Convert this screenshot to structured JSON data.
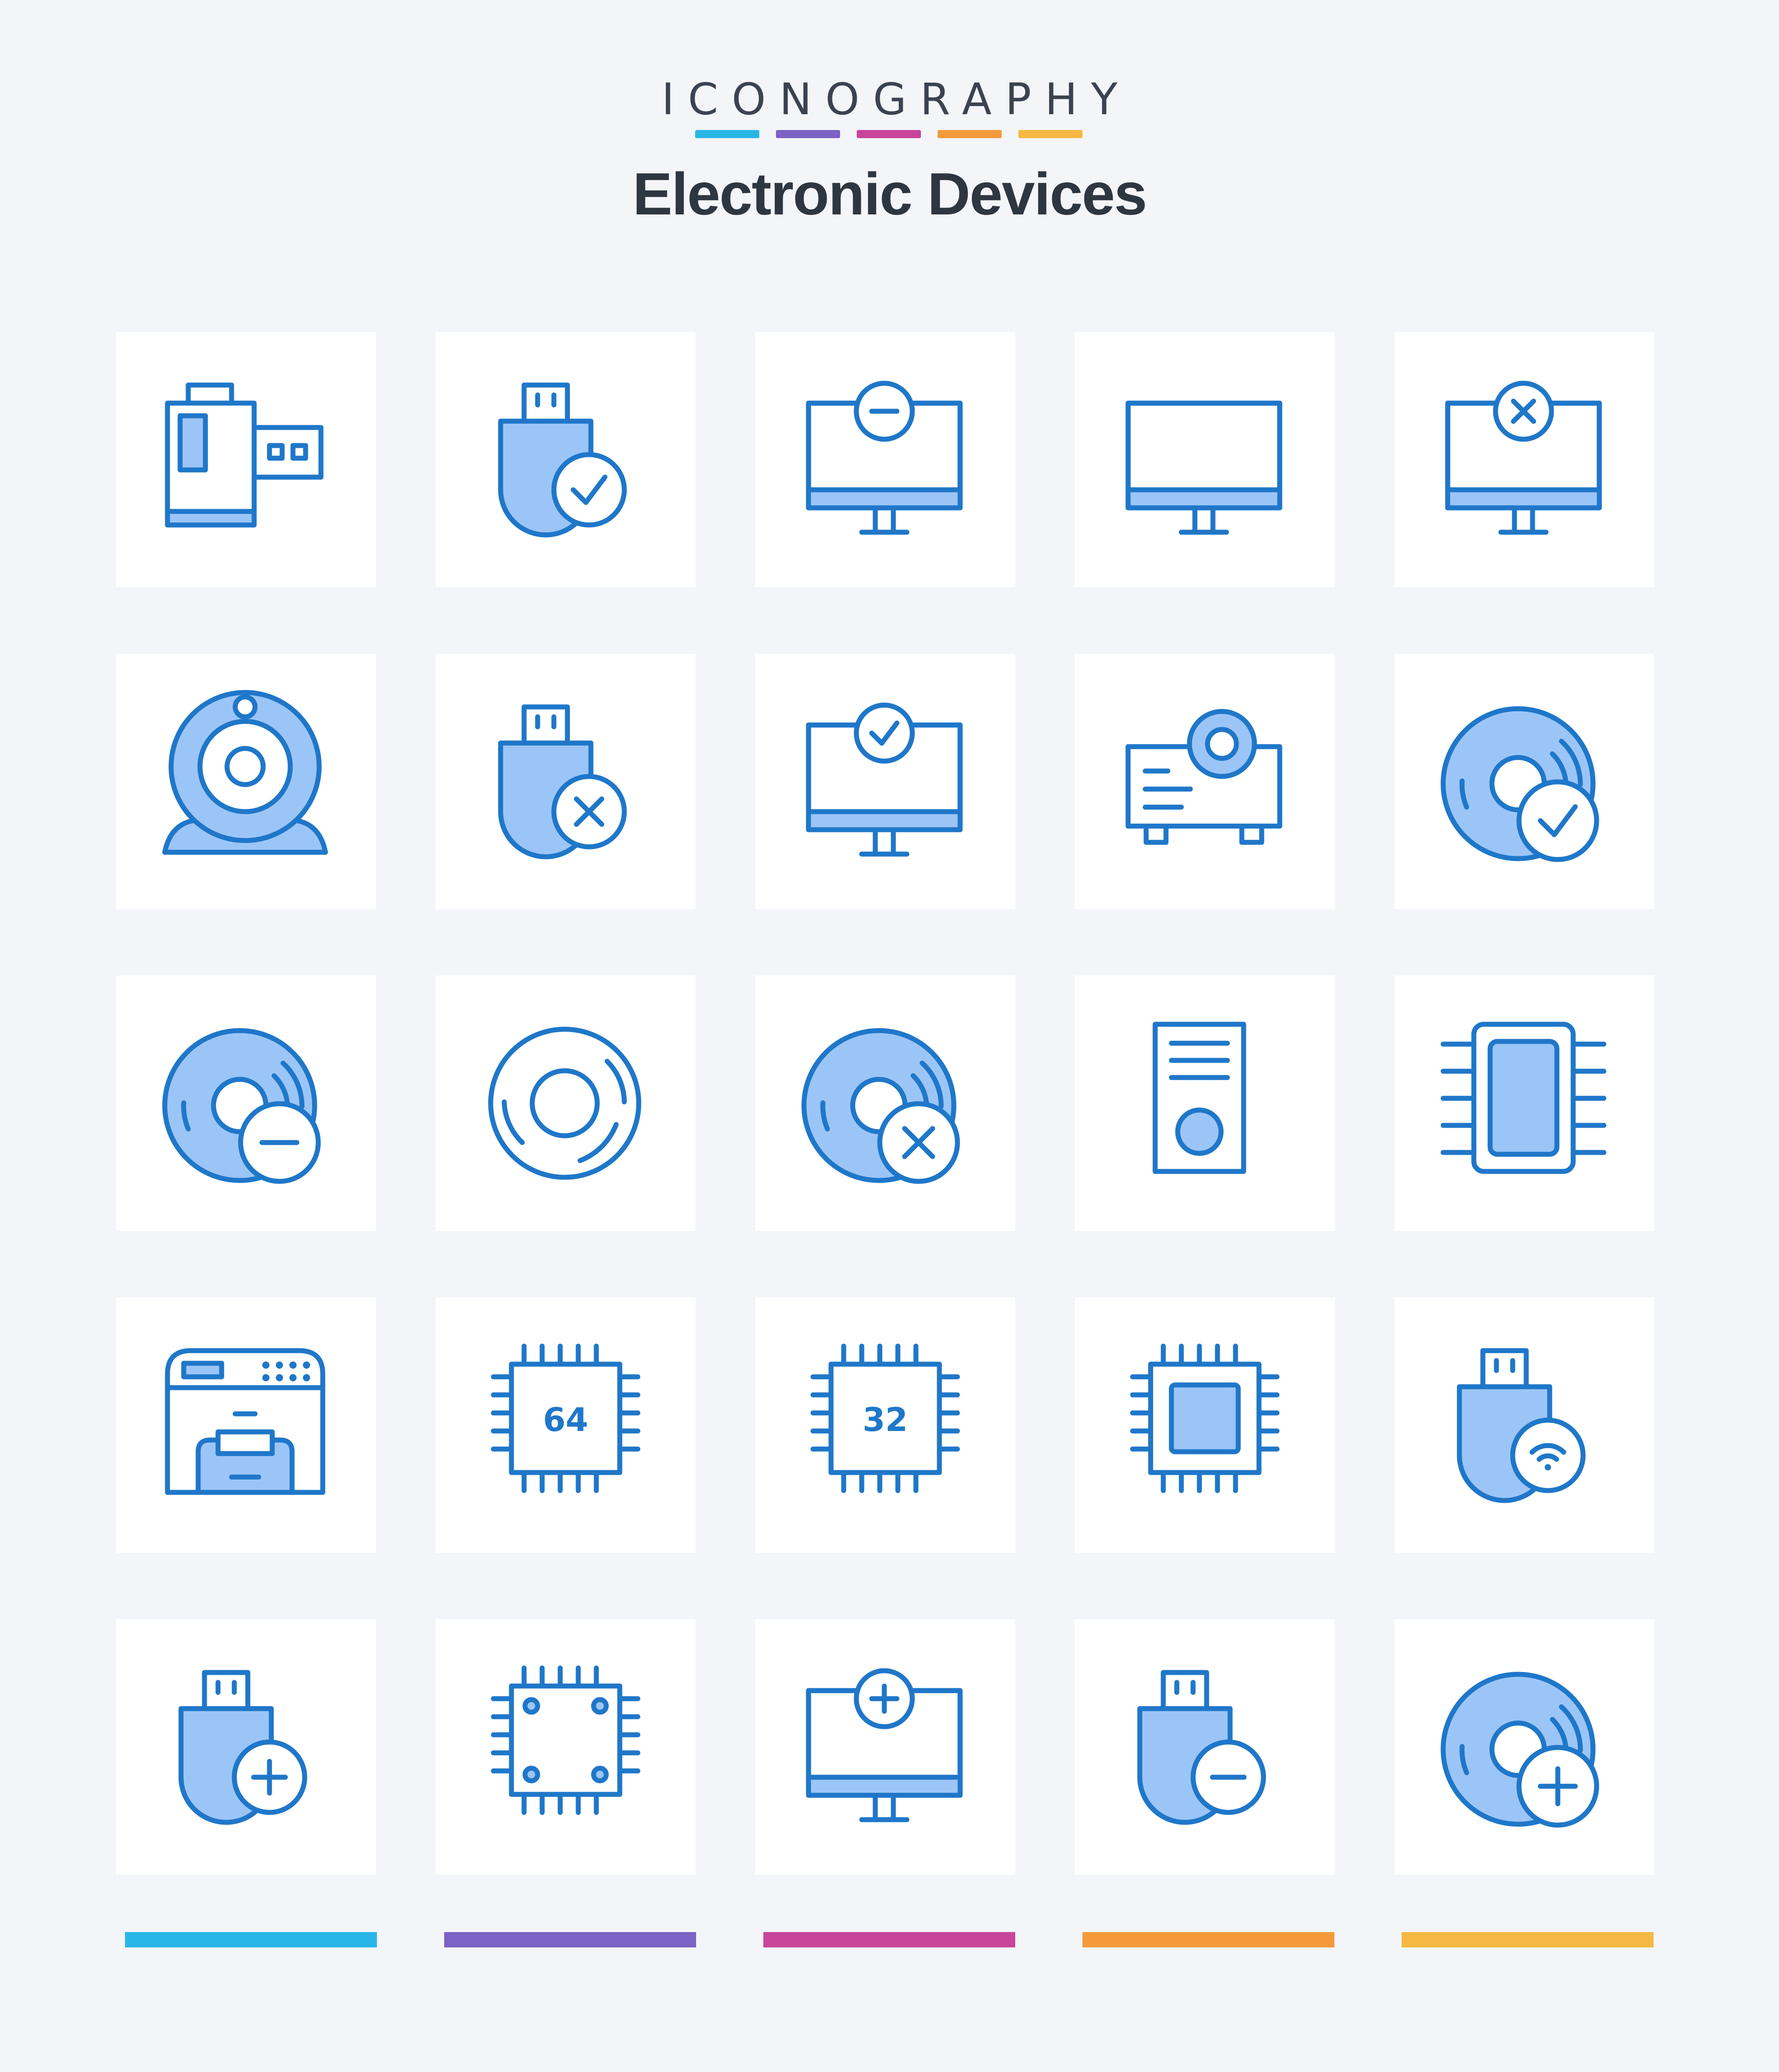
{
  "header": {
    "brand": "ICONOGRAPHY",
    "title": "Electronic Devices",
    "bar_colors": [
      "#29b6e6",
      "#7b62c4",
      "#c9449b",
      "#f49a3b",
      "#f5b843"
    ]
  },
  "icon_style": {
    "stroke": "#1f77c9",
    "fill": "#9cc5f7",
    "background": "#ffffff"
  },
  "icons": [
    {
      "name": "film-roll-icon"
    },
    {
      "name": "usb-check-icon"
    },
    {
      "name": "monitor-minus-icon"
    },
    {
      "name": "monitor-icon"
    },
    {
      "name": "monitor-close-icon"
    },
    {
      "name": "webcam-icon"
    },
    {
      "name": "usb-close-icon"
    },
    {
      "name": "monitor-check-icon"
    },
    {
      "name": "projector-icon"
    },
    {
      "name": "disc-check-icon"
    },
    {
      "name": "disc-minus-icon"
    },
    {
      "name": "disc-icon"
    },
    {
      "name": "disc-close-icon"
    },
    {
      "name": "speaker-icon"
    },
    {
      "name": "memory-chip-icon"
    },
    {
      "name": "printer-icon"
    },
    {
      "name": "chip-64-icon",
      "label": "64"
    },
    {
      "name": "chip-32-icon",
      "label": "32"
    },
    {
      "name": "cpu-icon"
    },
    {
      "name": "usb-wireless-icon"
    },
    {
      "name": "usb-add-icon"
    },
    {
      "name": "chip-board-icon"
    },
    {
      "name": "monitor-add-icon"
    },
    {
      "name": "usb-minus-icon"
    },
    {
      "name": "disc-add-icon"
    }
  ],
  "footer": {
    "bar_colors": [
      "#29b6e6",
      "#7b62c4",
      "#c9449b",
      "#f49a3b",
      "#f5b843"
    ]
  }
}
